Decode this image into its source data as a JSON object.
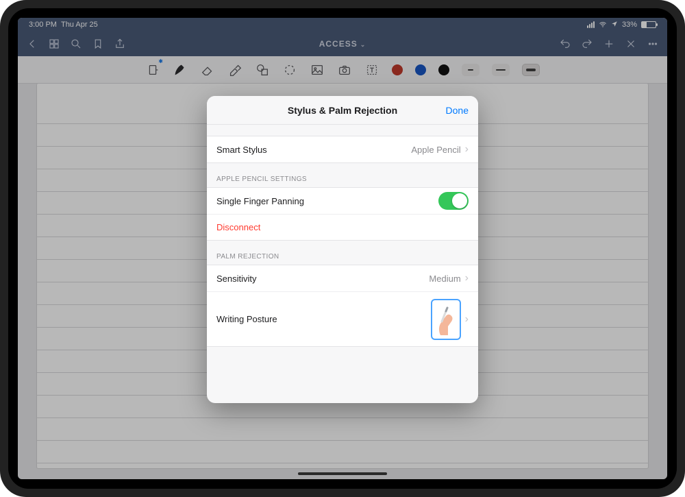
{
  "status": {
    "time": "3:00 PM",
    "date": "Thu Apr 25",
    "battery": "33%"
  },
  "nav": {
    "title": "ACCESS"
  },
  "toolbar": {
    "colors": {
      "red": "#c0392b",
      "blue": "#1857c4",
      "black": "#111"
    },
    "strokes": {
      "thin": 8,
      "med": 14,
      "thick": 14
    }
  },
  "modal": {
    "title": "Stylus & Palm Rejection",
    "done": "Done",
    "smart_stylus": {
      "label": "Smart Stylus",
      "value": "Apple Pencil"
    },
    "sections": {
      "pencil": {
        "header": "APPLE PENCIL SETTINGS",
        "panning": "Single Finger Panning",
        "disconnect": "Disconnect"
      },
      "palm": {
        "header": "PALM REJECTION",
        "sensitivity": {
          "label": "Sensitivity",
          "value": "Medium"
        },
        "posture": "Writing Posture"
      }
    }
  }
}
